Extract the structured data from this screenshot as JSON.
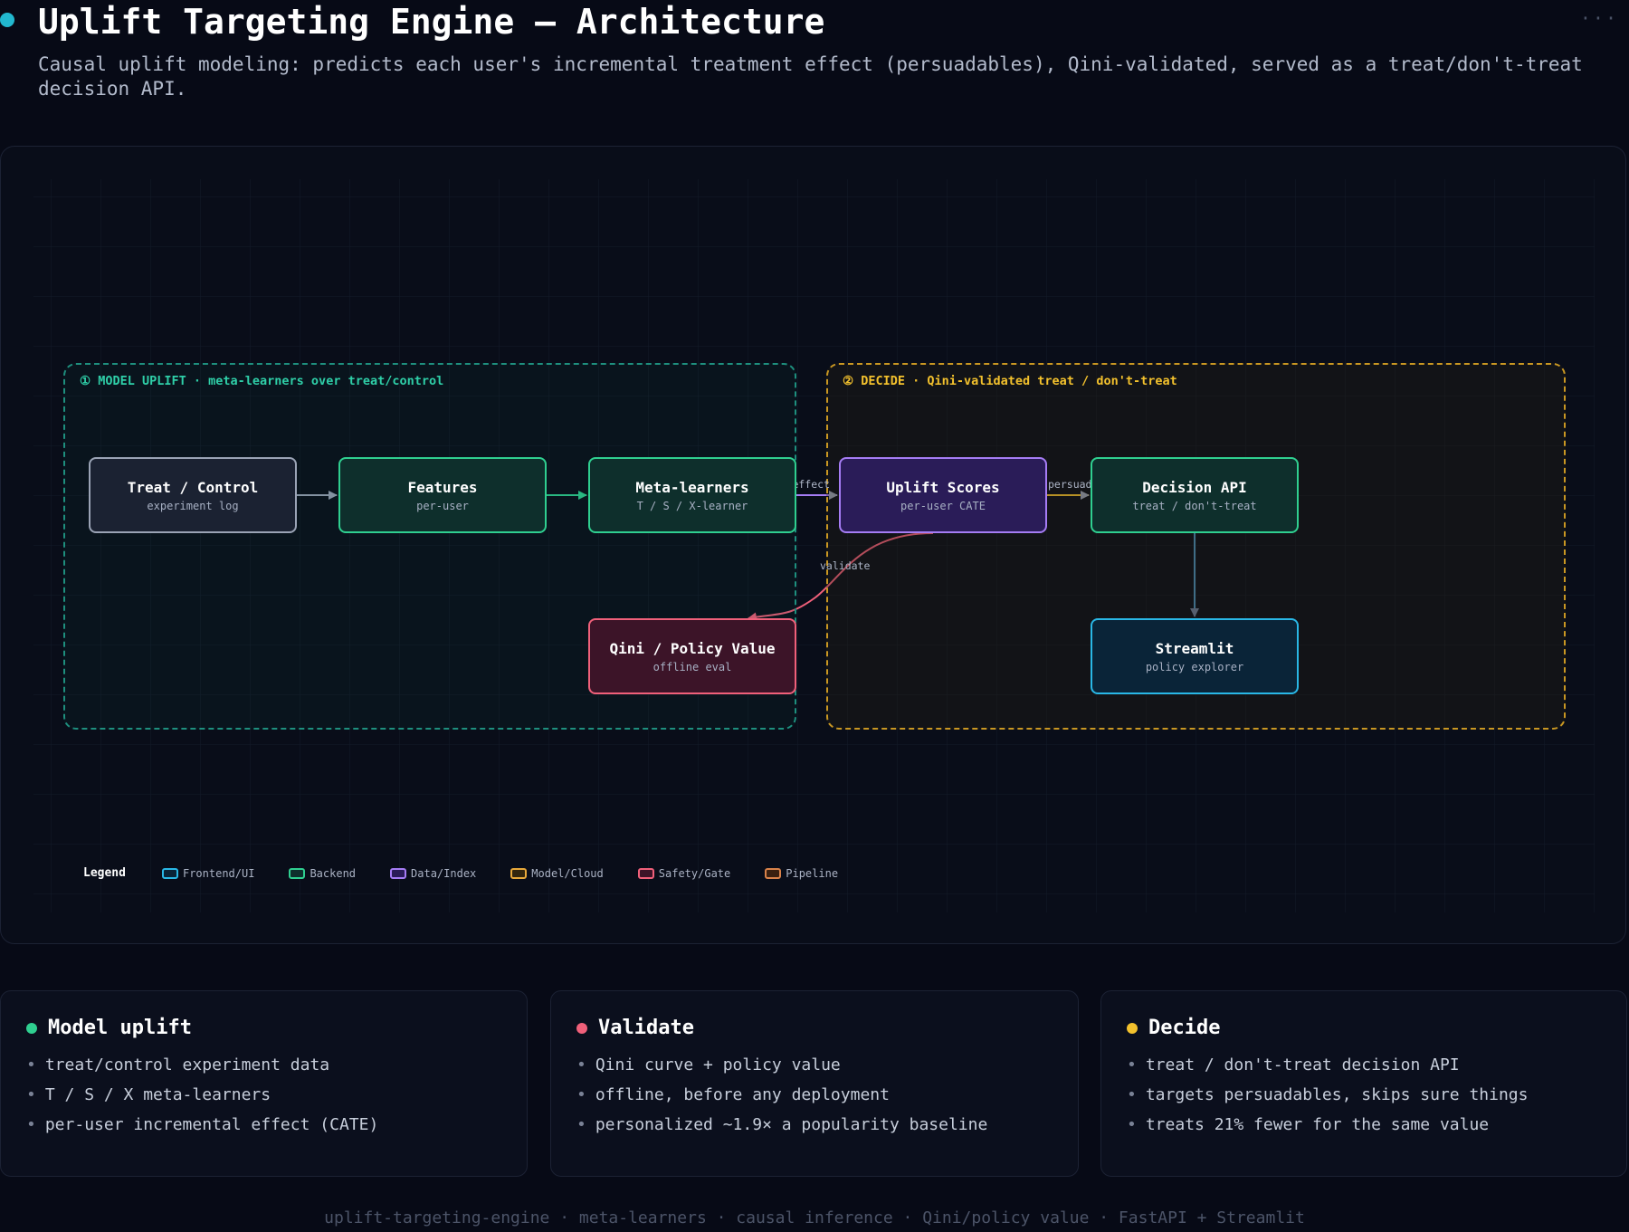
{
  "header": {
    "title": "Uplift Targeting Engine — Architecture",
    "subtitle": "Causal uplift modeling: predicts each user's incremental treatment effect (persuadables), Qini-validated, served as a treat/don't-treat decision API.",
    "more_icon": "more-horizontal-icon"
  },
  "diagram": {
    "groups": [
      {
        "label": "① MODEL UPLIFT · meta-learners over treat/control",
        "color": "#2fcfa8"
      },
      {
        "label": "② DECIDE · Qini-validated treat / don't-treat",
        "color": "#f3c12d"
      }
    ],
    "nodes": {
      "treat_control": {
        "title": "Treat / Control",
        "subtitle": "experiment log"
      },
      "features": {
        "title": "Features",
        "subtitle": "per-user"
      },
      "meta_learners": {
        "title": "Meta-learners",
        "subtitle": "T / S / X-learner"
      },
      "uplift_scores": {
        "title": "Uplift Scores",
        "subtitle": "per-user CATE"
      },
      "decision_api": {
        "title": "Decision API",
        "subtitle": "treat / don't-treat"
      },
      "qini": {
        "title": "Qini / Policy Value",
        "subtitle": "offline eval"
      },
      "streamlit": {
        "title": "Streamlit",
        "subtitle": "policy explorer"
      }
    },
    "edge_labels": {
      "meta_to_uplift": "incremental effect",
      "uplift_to_decision": "persuadables",
      "uplift_to_qini": "validate"
    }
  },
  "legend": {
    "title": "Legend",
    "items": [
      {
        "label": "Frontend/UI",
        "color": "#29b7e6"
      },
      {
        "label": "Backend",
        "color": "#2fcf90"
      },
      {
        "label": "Data/Index",
        "color": "#a57cf4"
      },
      {
        "label": "Model/Cloud",
        "color": "#e8a83a"
      },
      {
        "label": "Safety/Gate",
        "color": "#f0607a"
      },
      {
        "label": "Pipeline",
        "color": "#d9824a"
      }
    ]
  },
  "cards": [
    {
      "title": "Model uplift",
      "color": "#2fcf90",
      "items": [
        "treat/control experiment data",
        "T / S / X meta-learners",
        "per-user incremental effect (CATE)"
      ]
    },
    {
      "title": "Validate",
      "color": "#f0607a",
      "items": [
        "Qini curve + policy value",
        "offline, before any deployment",
        "personalized ~1.9× a popularity baseline"
      ]
    },
    {
      "title": "Decide",
      "color": "#f3c12d",
      "items": [
        "treat / don't-treat decision API",
        "targets persuadables, skips sure things",
        "treats 21% fewer for the same value"
      ]
    }
  ],
  "footer": "uplift-targeting-engine · meta-learners · causal inference · Qini/policy value · FastAPI + Streamlit"
}
